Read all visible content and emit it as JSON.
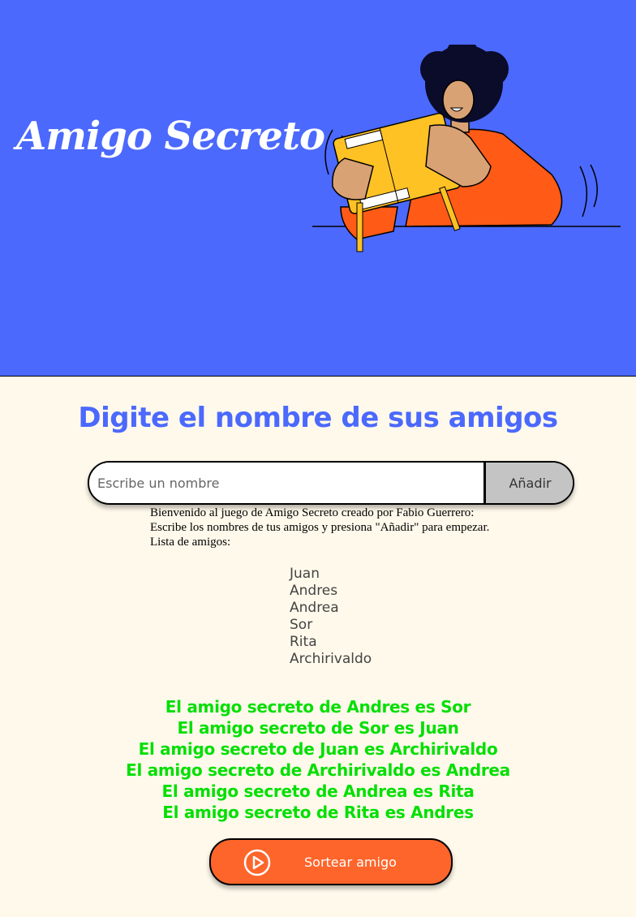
{
  "header": {
    "title": "Amigo Secreto",
    "background_color": "#4B69FD",
    "illustration": "person-opening-gift-box"
  },
  "main": {
    "subtitle": "Digite el nombre de sus amigos",
    "input": {
      "placeholder": "Escribe un nombre",
      "value": ""
    },
    "add_button_label": "Añadir",
    "intro_lines": [
      "Bienvenido al juego de Amigo Secreto creado por Fabio Guerrero:",
      "Escribe los nombres de tus amigos y presiona \"Añadir\" para empezar.",
      "Lista de amigos:"
    ],
    "friends": [
      "Juan",
      "Andres",
      "Andrea",
      "Sor",
      "Rita",
      "Archirivaldo"
    ],
    "results": [
      "El amigo secreto de Andres es Sor",
      "El amigo secreto de Sor es Juan",
      "El amigo secreto de Juan es Archirivaldo",
      "El amigo secreto de Archirivaldo es Andrea",
      "El amigo secreto de Andrea es Rita",
      "El amigo secreto de Rita es Andres"
    ],
    "draw_button": {
      "label": "Sortear amigo",
      "icon": "play-circle-icon"
    }
  },
  "colors": {
    "accent": "#4B69FD",
    "page_background": "#FFF9EB",
    "result_text": "#05DF05",
    "draw_button": "#FE652B",
    "add_button": "#C4C4C4"
  }
}
